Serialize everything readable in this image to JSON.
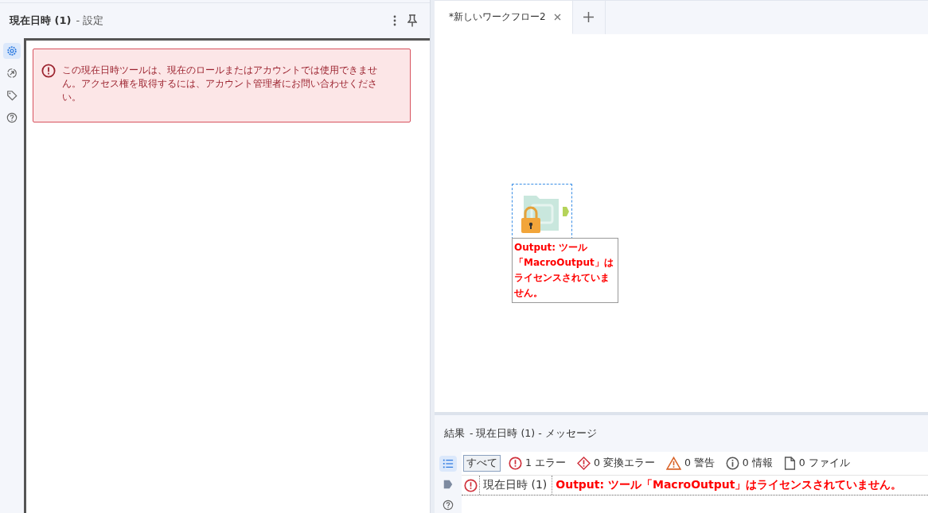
{
  "config_panel": {
    "title": "現在日時 (1)",
    "subtitle": "- 設定",
    "side_tabs": [
      {
        "selected": true
      },
      {
        "selected": false
      },
      {
        "selected": false
      },
      {
        "selected": false
      }
    ],
    "error_banner": "この現在日時ツールは、現在のロールまたはアカウントでは使用できません。アクセス権を取得するには、アカウント管理者にお問い合わせください。"
  },
  "tabs": [
    {
      "label": "*新しいワークフロー2",
      "selected": true
    }
  ],
  "canvas": {
    "tool": {
      "selected": true,
      "locked": true,
      "error": "Output: ツール「MacroOutput」はライセンスされていません。"
    }
  },
  "results": {
    "title": "結果",
    "context": "- 現在日時 (1) - メッセージ",
    "side_tabs": [
      {
        "selected": true
      },
      {
        "selected": false
      },
      {
        "selected": false
      }
    ],
    "filters": [
      {
        "kind": "all",
        "label": "すべて",
        "selected": true
      },
      {
        "kind": "error",
        "label": "1 エラー",
        "selected": false
      },
      {
        "kind": "conversion_error",
        "label": "0 変換エラー",
        "selected": false
      },
      {
        "kind": "warning",
        "label": "0 警告",
        "selected": false
      },
      {
        "kind": "info",
        "label": "0 情報",
        "selected": false
      },
      {
        "kind": "file",
        "label": "0 ファイル",
        "selected": false
      }
    ],
    "messages": [
      {
        "kind": "error",
        "tool": "現在日時 (1)",
        "text": "Output: ツール「MacroOutput」はライセンスされていません。"
      }
    ]
  }
}
